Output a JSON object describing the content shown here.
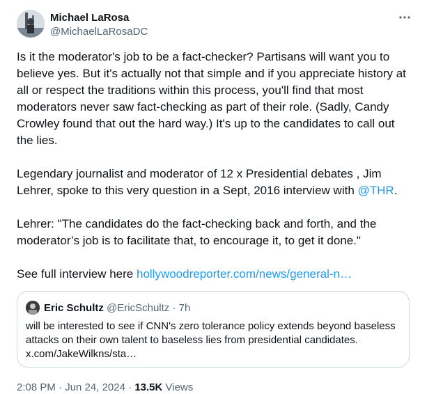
{
  "author": {
    "name": "Michael LaRosa",
    "handle": "@MichaelLaRosaDC"
  },
  "menu_icon": "more-horizontal-icon",
  "post": {
    "paragraph1": "Is it the moderator's job to be a fact-checker? Partisans will want you to believe yes. But it's actually not that simple and if you appreciate history at all or respect the traditions within this process, you'll find that most moderators never saw fact-checking as part of their role. (Sadly, Candy Crowley found that out the hard way.)  It's up to the candidates to call out the lies.",
    "paragraph2_text": "Legendary journalist and moderator of 12 x Presidential debates , Jim Lehrer, spoke to this very question in a Sept, 2016 interview with ",
    "paragraph2_mention": "@THR",
    "paragraph2_end": ".",
    "paragraph3": "Lehrer: \"The candidates do the fact-checking back and forth, and the moderator’s job is to facilitate that, to encourage it, to get it done.\"",
    "paragraph4_text": "See full interview here ",
    "paragraph4_link": "hollywoodreporter.com/news/general-n…"
  },
  "quoted_post": {
    "name": "Eric Schultz",
    "handle": "@EricSchultz",
    "separator": "·",
    "time": "7h",
    "text": "will be interested to see if CNN's zero tolerance policy extends beyond baseless attacks on their own talent to baseless lies from presidential candidates. x.com/JakeWilkns/sta…"
  },
  "footer": {
    "time": "2:08 PM",
    "dot1": "·",
    "date": "Jun 24, 2024",
    "dot2": "·",
    "views_count": "13.5K",
    "views_label": "Views"
  },
  "colors": {
    "text": "#0f1419",
    "secondary": "#536471",
    "link": "#1d9bf0",
    "border": "#cfd9de"
  }
}
